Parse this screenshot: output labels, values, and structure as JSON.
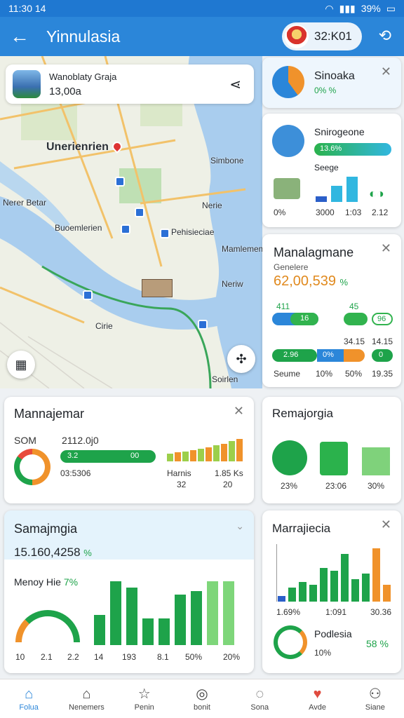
{
  "status": {
    "time": "11:30 14",
    "battery": "39%"
  },
  "header": {
    "title": "Yinnulasia",
    "user_code": "32:K01"
  },
  "map": {
    "location": {
      "name": "Wanoblaty Graja",
      "value": "13,00a"
    },
    "labels": [
      "Unerienrien",
      "Simbone",
      "Nerer Betar",
      "Buoemlerien",
      "Pehisieciae",
      "Nerie",
      "Mamlemem",
      "Cirie",
      "Neriw",
      "Soirlen"
    ]
  },
  "card_sinoaka": {
    "title": "Sinoaka",
    "value": "0% %"
  },
  "card_snirogeone": {
    "title": "Snirogeone",
    "bar_label": "13.6%",
    "sub": "Seege",
    "values": [
      "0%",
      "3000",
      "1:03",
      "2.12"
    ],
    "bars": [
      0.2,
      0.6,
      0.95
    ]
  },
  "card_manalagmane": {
    "title": "Manalagmane",
    "sub": "Genelere",
    "big": "62,00,539",
    "big_suffix": "%",
    "n1": "411",
    "n2": "45",
    "p1": "16",
    "p2": "96",
    "n3": "34.15",
    "n4": "14.15",
    "bottom": [
      "Seume",
      "10%",
      "50%",
      "19.35"
    ],
    "seg1": "2.96",
    "seg2": "0%",
    "seg3": "0"
  },
  "card_mannajemar": {
    "title": "Mannajemar",
    "k1": "SOM",
    "k2": "2112.0j0",
    "bar1": "3.2",
    "bar2": "00",
    "sub": "03:5306",
    "l1": "Harnis",
    "l2": "1.85 Ks",
    "v1": "32",
    "v2": "20",
    "bars": [
      0.3,
      0.35,
      0.4,
      0.45,
      0.5,
      0.55,
      0.65,
      0.7,
      0.8,
      0.9
    ]
  },
  "card_remajorgia": {
    "title": "Remajorgia",
    "values": [
      "23%",
      "23:06",
      "30%"
    ]
  },
  "card_samajmgia": {
    "title": "Samajmgia",
    "big": "15.160,4258",
    "big_suffix": "%",
    "sub": "Menoy Hie",
    "sub_pct": "7%",
    "axis": [
      "10",
      "2.1",
      "2.2",
      "14",
      "193",
      "8.1",
      "50%",
      "20%"
    ],
    "bars": [
      0.45,
      0.95,
      0.85,
      0.4,
      0.4,
      0.75,
      0.8,
      0.95,
      0.95
    ]
  },
  "card_marrajiecia": {
    "title": "Marrajiecia",
    "xlab1": "1.69%",
    "xlab2": "1:091",
    "xlab3": "30.36",
    "bars": [
      0.1,
      0.25,
      0.35,
      0.3,
      0.6,
      0.55,
      0.85,
      0.4,
      0.5,
      0.95,
      0.3
    ],
    "item": "Podlesia",
    "item_val": "10%",
    "item_pct": "58 %"
  },
  "tabs": [
    "Folua",
    "Nenemers",
    "Penin",
    "bonit",
    "Sona",
    "Avde",
    "Siane"
  ],
  "colors": {
    "primary": "#2b86d9",
    "green": "#1ea34a",
    "orange": "#f0922b"
  }
}
